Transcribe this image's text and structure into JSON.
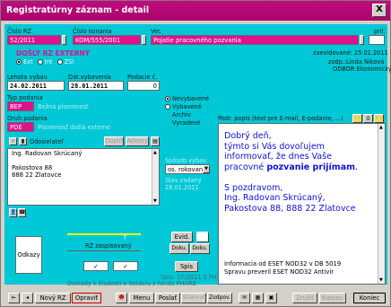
{
  "window": {
    "title": "Registratúrny záznam - detail",
    "close_label": "X"
  },
  "header": {
    "cislo_rz_label": "Číslo RZ",
    "cislo_rz_value": "52/2011",
    "cislo_konania_label": "Číslo konania",
    "cislo_konania_value": "KOM/555/2001",
    "vec_label": "Vec",
    "vec_value": "Pojatie pracovného pozvania",
    "pril_label": "pril.",
    "dosly_label": "DOŠLÝ RZ EXTERNÝ",
    "radio_ext": "Ext",
    "radio_int": "Int",
    "radio_zsi": "ZSI",
    "zaevidovane_label": "zaevidované:",
    "zaevidovane_value": "25.01.2011",
    "zodp_label": "zodp.:",
    "zodp_value": "Linda Niková",
    "oddbor_value": "ODBOR Ekonomický"
  },
  "left": {
    "lehota_label": "Lehota vybav.",
    "lehota_value": "24.02.2011",
    "dat_vyb_label": "Dát.vybavenia",
    "dat_vyb_value": "28.01.2011",
    "podacie_label": "Podacie č.",
    "podacie_value": "0",
    "typ_label": "Typ podania",
    "typ_value": "BEP",
    "typ_desc": "Bežná písomnosť",
    "druh_label": "Druh podania",
    "druh_value": "PDE",
    "druh_desc": "Písomnosť došlá externe",
    "odosielatel_label": "Odosielateľ",
    "doplnit_label": "Doplň",
    "adresy_label": "Adresy",
    "sender_lines": [
      "Ing. Radovan Skrúcaný",
      "",
      "Pakostova 88",
      "888 22 Zlatovce"
    ],
    "stav_options": [
      "Nevybavené",
      "Vybavené",
      "Archív",
      "Vyradené"
    ],
    "sposob_label": "Spôsob vybav.",
    "sposob_value": "os. rokovan",
    "stav_zadany_label": "Stav zadaný",
    "stav_zadany_value": "28.01.2011"
  },
  "lower": {
    "odkazy_label": "Odkazy",
    "question_mark": "?",
    "rz_zaspisovany_label": "RZ zaspisovaný",
    "check1": "✓",
    "check2": "✓",
    "evid_label": "Evid.",
    "doku1_label": "Doku.",
    "doku2_label": "Doku.",
    "spis_label": "Spis",
    "spis_ref": "Spis: 37/2011  S PH2",
    "doklady_text": "Doklady k žiadosti o dotáciu z fondu PHARE"
  },
  "right": {
    "popis_label": "Podr. popis (text pre E-mail, E-podanie, ...)",
    "text_lines": [
      "Dobrý deň,",
      "týmto si Vás dovoľujem",
      "informovať, že dnes Vaše",
      "pracovné "
    ],
    "bold_word": "pozvanie prijímam",
    "bold_tail": ".",
    "regards_lines": [
      "S pozdravom,",
      "Ing. Radovan Skrúcaný,",
      "Pakostova 88, 888 22 Zlatovce"
    ],
    "eset_lines": [
      "Informacia od ESET NOD32 v DB 5019",
      "Spravu preveril ESET NOD32 Antivir"
    ]
  },
  "toolbar": {
    "novy_rz": "Nový RZ",
    "opravit": "Opraviť",
    "menu": "Menu",
    "poslat": "Poslať",
    "stiahnut": "Stiahnuť",
    "zodpov": "Zodpov.",
    "zrusit": "Zrušiť",
    "nastav": "Nastav.",
    "koniec": "Koniec"
  },
  "colors": {
    "title": "#b8087a",
    "form": "#00c8d6",
    "magenta": "#e0118d",
    "text_blue": "#1010e0"
  }
}
